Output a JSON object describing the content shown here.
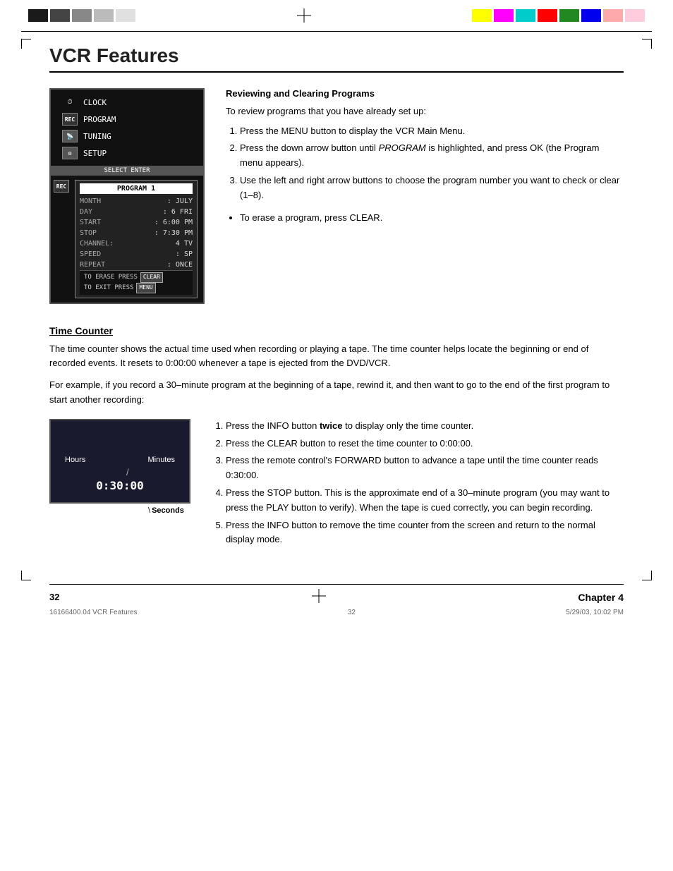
{
  "page": {
    "title": "VCR Features",
    "chapter": "Chapter 4",
    "page_number": "32",
    "footer_file": "16166400.04 VCR Features",
    "footer_page": "32",
    "footer_date": "5/29/03, 10:02 PM"
  },
  "color_bars_left": [
    {
      "color": "#000000"
    },
    {
      "color": "#444444"
    },
    {
      "color": "#888888"
    },
    {
      "color": "#bbbbbb"
    },
    {
      "color": "#dddddd"
    }
  ],
  "color_bars_right": [
    {
      "color": "#ffff00"
    },
    {
      "color": "#ff00ff"
    },
    {
      "color": "#00ffff"
    },
    {
      "color": "#ff0000"
    },
    {
      "color": "#00aa00"
    },
    {
      "color": "#0000ff"
    },
    {
      "color": "#ff8888"
    },
    {
      "color": "#ffaacc"
    }
  ],
  "vcr_menu": {
    "items": [
      {
        "label": "CLOCK",
        "icon": "clock"
      },
      {
        "label": "PROGRAM",
        "icon": "rec"
      },
      {
        "label": "TUNING",
        "icon": "tuning"
      },
      {
        "label": "SETUP",
        "icon": "setup"
      }
    ],
    "select_bar": "SELECT  ENTER",
    "program_submenu": {
      "title": "PROGRAM 1",
      "rows": [
        {
          "label": "MONTH",
          "value": ": JULY"
        },
        {
          "label": "DAY",
          "value": ": 6  FRI"
        },
        {
          "label": "START",
          "value": ": 6:00 PM"
        },
        {
          "label": "STOP",
          "value": ": 7:30 PM"
        },
        {
          "label": "CHANNEL:",
          "value": "4  TV"
        },
        {
          "label": "SPEED",
          "value": ": SP"
        },
        {
          "label": "REPEAT",
          "value": ": ONCE"
        }
      ],
      "hints": [
        {
          "text": "TO ERASE PRESS",
          "btn": "CLEAR"
        },
        {
          "text": "TO EXIT  PRESS",
          "btn": "MENU"
        }
      ]
    }
  },
  "reviewing_section": {
    "heading": "Reviewing and Clearing Programs",
    "intro": "To review programs that you have already set up:",
    "steps": [
      "Press the MENU button to display the VCR Main Menu.",
      "Press the down arrow button until PROGRAM is highlighted, and press OK (the Program menu appears).",
      "Use the left and right arrow buttons to choose the program number you want to check or clear (1–8)."
    ],
    "bullet": "To erase a program, press CLEAR."
  },
  "time_counter_section": {
    "title": "Time Counter",
    "paragraphs": [
      "The time counter shows the actual time used when recording or playing a tape. The time counter helps locate the beginning or end of recorded events. It resets to 0:00:00 whenever a tape is ejected from the DVD/VCR.",
      "For example, if you record a 30–minute program at the beginning of a tape, rewind it, and then want to go to the end of the first program to start another recording:"
    ],
    "diagram": {
      "hours_label": "Hours",
      "minutes_label": "Minutes",
      "time_display": "0:30:00",
      "seconds_label": "Seconds"
    },
    "steps": [
      "Press the INFO button twice to display only the time counter.",
      "Press the CLEAR button to reset the time counter to 0:00:00.",
      "Press the remote control's FORWARD button to advance a tape until the time counter reads 0:30:00.",
      "Press the STOP button. This is the approximate end of a 30–minute program (you may want to press the PLAY button to verify). When the tape is cued correctly, you can begin recording.",
      "Press the INFO button to remove the time counter from the screen and return to the normal display mode."
    ]
  }
}
